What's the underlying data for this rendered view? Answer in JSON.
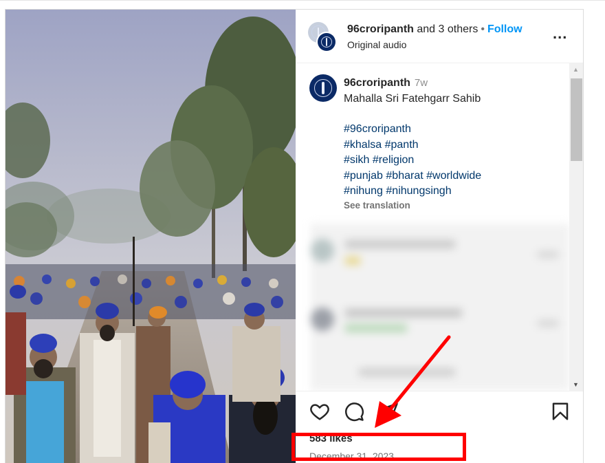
{
  "header": {
    "username": "96croripanth",
    "and_text": "and 3 others",
    "dot": "•",
    "follow_label": "Follow",
    "audio": "Original audio",
    "more": "..."
  },
  "caption": {
    "username": "96croripanth",
    "time": "7w",
    "text": "Mahalla Sri Fatehgarr Sahib",
    "tags_line1": "#96croripanth",
    "tags_line2": [
      "#khalsa",
      "#panth"
    ],
    "tags_line3": [
      "#sikh",
      "#religion"
    ],
    "tags_line4": [
      "#punjab",
      "#bharat",
      "#worldwide"
    ],
    "tags_line5": [
      "#nihung",
      "#nihungsingh"
    ],
    "see_translation": "See translation"
  },
  "footer": {
    "likes": "583 likes",
    "date": "December 31, 2023"
  },
  "icons": [
    "like-icon",
    "comment-icon",
    "share-icon",
    "save-icon",
    "more-icon"
  ],
  "colors": {
    "follow_blue": "#0095f6",
    "hashtag_blue": "#00376b",
    "annotation_red": "#ff0000"
  }
}
